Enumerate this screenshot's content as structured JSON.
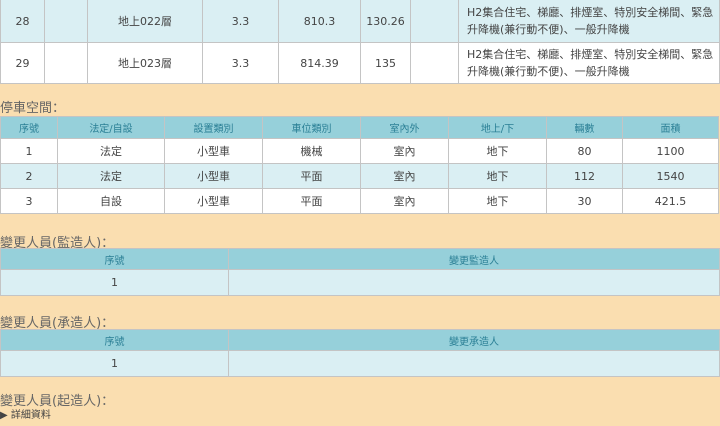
{
  "floors": {
    "rows": [
      {
        "no": "28",
        "c2": "",
        "floor": "地上022層",
        "height": "3.3",
        "c5": "810.3",
        "c6": "130.26",
        "c7": "",
        "use": "H2集合住宅、梯廳、排煙室、特別安全梯間、緊急升降機(兼行動不便)、一般升降機"
      },
      {
        "no": "29",
        "c2": "",
        "floor": "地上023層",
        "height": "3.3",
        "c5": "814.39",
        "c6": "135",
        "c7": "",
        "use": "H2集合住宅、梯廳、排煙室、特別安全梯間、緊急升降機(兼行動不便)、一般升降機"
      }
    ]
  },
  "parking": {
    "title": "停車空間：",
    "headers": [
      "序號",
      "法定/自設",
      "設置類別",
      "車位類別",
      "室內外",
      "地上/下",
      "輛數",
      "面積"
    ],
    "rows": [
      [
        "1",
        "法定",
        "小型車",
        "機械",
        "室內",
        "地下",
        "80",
        "1100"
      ],
      [
        "2",
        "法定",
        "小型車",
        "平面",
        "室內",
        "地下",
        "112",
        "1540"
      ],
      [
        "3",
        "自設",
        "小型車",
        "平面",
        "室內",
        "地下",
        "30",
        "421.5"
      ]
    ]
  },
  "supervisor": {
    "title": "變更人員(監造人)：",
    "headers": [
      "序號",
      "變更監造人"
    ],
    "rows": [
      [
        "1",
        ""
      ]
    ]
  },
  "contractor": {
    "title": "變更人員(承造人)：",
    "headers": [
      "序號",
      "變更承造人"
    ],
    "rows": [
      [
        "1",
        ""
      ]
    ]
  },
  "owner": {
    "title": "變更人員(起造人)：",
    "details": "▶ 詳細資料"
  }
}
